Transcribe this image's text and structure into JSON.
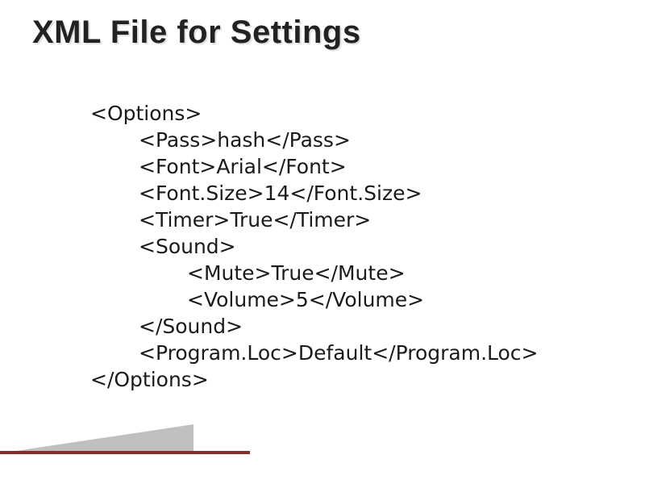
{
  "title": "XML File for Settings",
  "xml": {
    "open_options": "<Options>",
    "close_options": "</Options>",
    "lines": [
      {
        "open": "<Pass>",
        "value": "hash",
        "close": "</Pass>"
      },
      {
        "open": "<Font>",
        "value": "Arial",
        "close": "</Font>"
      },
      {
        "open": "<Font.Size>",
        "value": "14",
        "close": "</Font.Size>"
      },
      {
        "open": "<Timer>",
        "value": "True",
        "close": "</Timer>"
      }
    ],
    "sound_open": "<Sound>",
    "sound_close": "</Sound>",
    "sound_lines": [
      {
        "open": "<Mute>",
        "value": "True",
        "close": "</Mute>"
      },
      {
        "open": "<Volume>",
        "value": "5",
        "close": "</Volume>"
      }
    ],
    "program_loc": {
      "open": "<Program.Loc>",
      "value": "Default",
      "close": "</Program.Loc>"
    }
  }
}
